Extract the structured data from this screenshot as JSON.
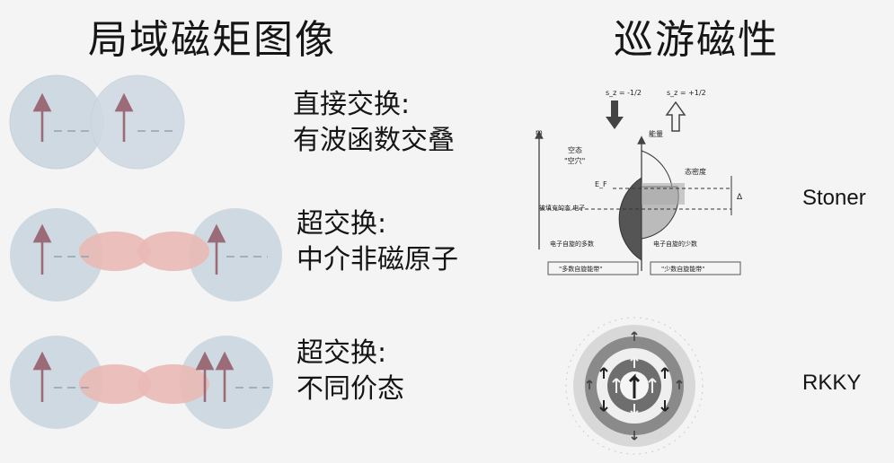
{
  "titles": {
    "left": "局域磁矩图像",
    "right": "巡游磁性"
  },
  "rows": [
    {
      "line1": "直接交换:",
      "line2": "有波函数交叠"
    },
    {
      "line1": "超交换:",
      "line2": "中介非磁原子"
    },
    {
      "line1": "超交换:",
      "line2": "不同价态"
    }
  ],
  "right_labels": {
    "stoner": "Stoner",
    "rkky": "RKKY"
  },
  "stoner_diagram": {
    "spin_up_label": "s_z = -1/2",
    "spin_down_label": "s_z = +1/2",
    "energy_axis": "能量",
    "left_axis": "m",
    "empty_state": "空态",
    "hole": "\"空穴\"",
    "fermi": "E_F",
    "density": "态密度",
    "delta": "Δ",
    "filled": "被填充的态,电子",
    "majority": "电子自旋的多数",
    "minority": "电子自旋的少数",
    "majority_band": "\"多数自旋能带\"",
    "minority_band": "\"少数自旋能带\""
  },
  "colors": {
    "atom": "#cfd9e2",
    "orbital": "#e9b9b6",
    "arrow": "#9b6b78"
  }
}
